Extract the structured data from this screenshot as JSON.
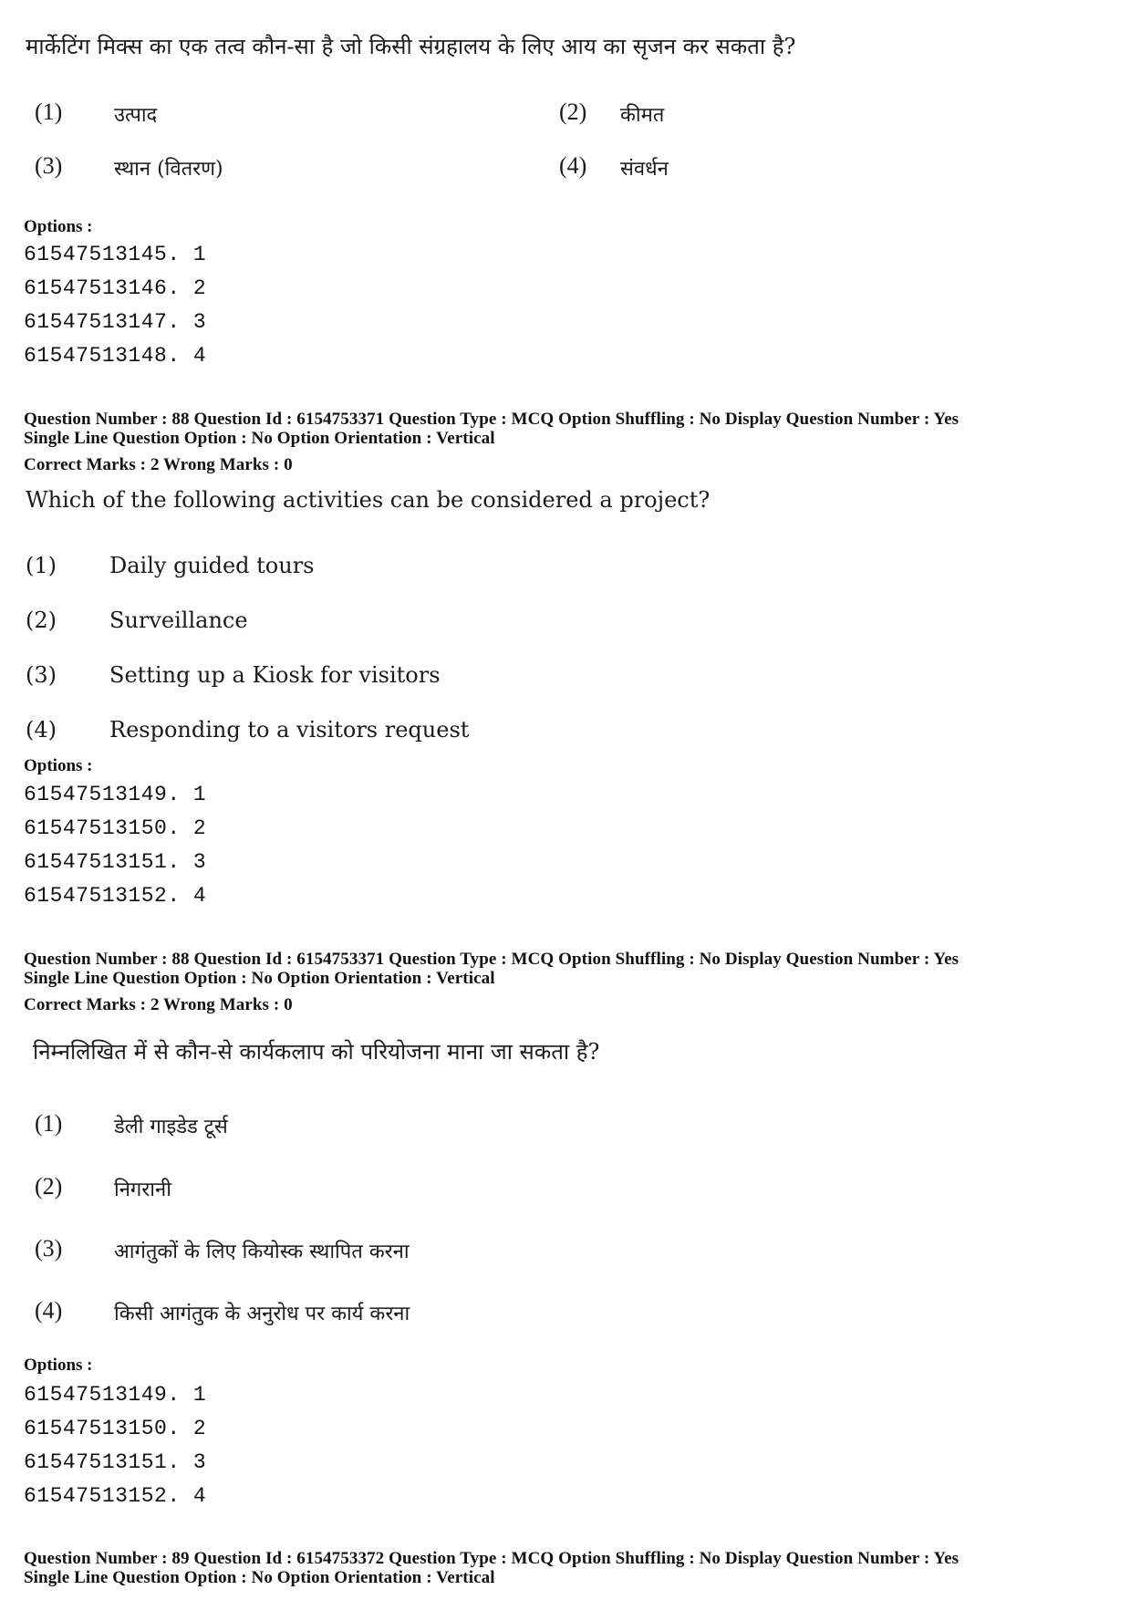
{
  "block1": {
    "question_text": "मार्केटिंग मिक्स का एक तत्व कौन-सा है जो किसी संग्रहालय के लिए आय का सृजन कर सकता है?",
    "options": [
      {
        "num": "(1)",
        "text": "उत्पाद"
      },
      {
        "num": "(2)",
        "text": "कीमत"
      },
      {
        "num": "(3)",
        "text": "स्थान (वितरण)"
      },
      {
        "num": "(4)",
        "text": "संवर्धन"
      }
    ],
    "options_label": "Options :",
    "option_ids": [
      "61547513145. 1",
      "61547513146. 2",
      "61547513147. 3",
      "61547513148. 4"
    ]
  },
  "block2": {
    "meta_line1": "Question Number : 88  Question Id : 6154753371  Question Type : MCQ  Option Shuffling : No  Display Question Number : Yes",
    "meta_line2": "Single Line Question Option : No  Option Orientation : Vertical",
    "marks": "Correct Marks : 2  Wrong Marks : 0",
    "question_text": "Which of the following activities can be considered a project?",
    "options": [
      {
        "num": "(1)",
        "text": "Daily guided tours"
      },
      {
        "num": "(2)",
        "text": "Surveillance"
      },
      {
        "num": "(3)",
        "text": "Setting up a Kiosk for visitors"
      },
      {
        "num": "(4)",
        "text": "Responding to a visitors request"
      }
    ],
    "options_label": "Options :",
    "option_ids": [
      "61547513149. 1",
      "61547513150. 2",
      "61547513151. 3",
      "61547513152. 4"
    ]
  },
  "block3": {
    "meta_line1": "Question Number : 88  Question Id : 6154753371  Question Type : MCQ  Option Shuffling : No  Display Question Number : Yes",
    "meta_line2": "Single Line Question Option : No  Option Orientation : Vertical",
    "marks": "Correct Marks : 2  Wrong Marks : 0",
    "question_text": "निम्नलिखित में से कौन-से कार्यकलाप को परियोजना माना जा सकता है?",
    "options": [
      {
        "num": "(1)",
        "text": "डेली गाइडेड टूर्स"
      },
      {
        "num": "(2)",
        "text": "निगरानी"
      },
      {
        "num": "(3)",
        "text": "आगंतुकों के लिए कियोस्क स्थापित करना"
      },
      {
        "num": "(4)",
        "text": "किसी आगंतुक के अनुरोध पर कार्य करना"
      }
    ],
    "options_label": "Options :",
    "option_ids": [
      "61547513149. 1",
      "61547513150. 2",
      "61547513151. 3",
      "61547513152. 4"
    ]
  },
  "block4": {
    "meta_line1": "Question Number : 89  Question Id : 6154753372  Question Type : MCQ  Option Shuffling : No  Display Question Number : Yes",
    "meta_line2": "Single Line Question Option : No  Option Orientation : Vertical"
  }
}
